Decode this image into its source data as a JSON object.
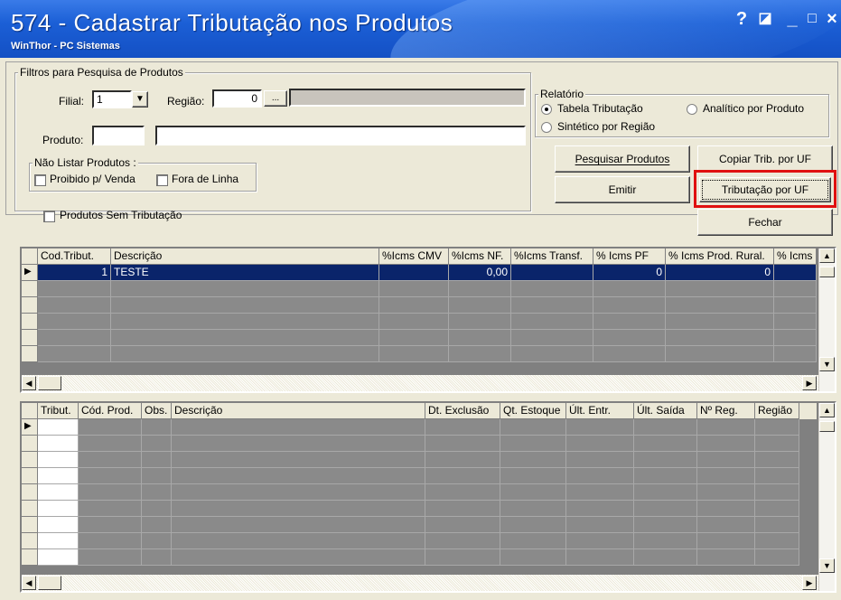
{
  "window": {
    "title": "574 - Cadastrar Tributação nos Produtos",
    "subtitle": "WinThor - PC Sistemas",
    "controls": [
      "?",
      "◪",
      "_",
      "□",
      "×"
    ]
  },
  "filters": {
    "legend": "Filtros para Pesquisa de Produtos",
    "filial_label": "Filial:",
    "filial_value": "1",
    "regiao_label": "Região:",
    "regiao_value": "0",
    "ellipsis": "...",
    "produto_label": "Produto:",
    "produto_code": "",
    "produto_desc": "",
    "nao_listar": {
      "legend": "Não Listar Produtos :",
      "proibido": "Proibido p/ Venda",
      "fora_linha": "Fora de Linha"
    },
    "sem_tributacao": "Produtos Sem Tributação"
  },
  "relatorio": {
    "legend": "Relatório",
    "options": [
      "Tabela Tributação",
      "Sintético por Região",
      "Analítico por Produto"
    ],
    "selected": "Tabela Tributação"
  },
  "buttons": {
    "pesquisar": "Pesquisar Produtos",
    "copiar": "Copiar Trib. por UF",
    "emitir": "Emitir",
    "tributacao_uf": "Tributação por UF",
    "fechar": "Fechar"
  },
  "grid1": {
    "columns": [
      "Cod.Tribut.",
      "Descrição",
      "%Icms CMV",
      "%Icms NF.",
      "%Icms Transf.",
      "% Icms PF",
      "% Icms Prod. Rural.",
      "% Icms"
    ],
    "rows": [
      [
        "1",
        "TESTE",
        "",
        "0,00",
        "",
        "0",
        "0",
        ""
      ]
    ]
  },
  "grid2": {
    "columns": [
      "Tribut.",
      "Cód. Prod.",
      "Obs.",
      "Descrição",
      "Dt. Exclusão",
      "Qt. Estoque",
      "Últ. Entr.",
      "Últ. Saída",
      "Nº Reg.",
      "Região"
    ]
  },
  "colors": {
    "titlebar": "#1b5fd6",
    "selection": "#0a246a",
    "highlight": "#e01010",
    "grid_bg": "#808080"
  }
}
